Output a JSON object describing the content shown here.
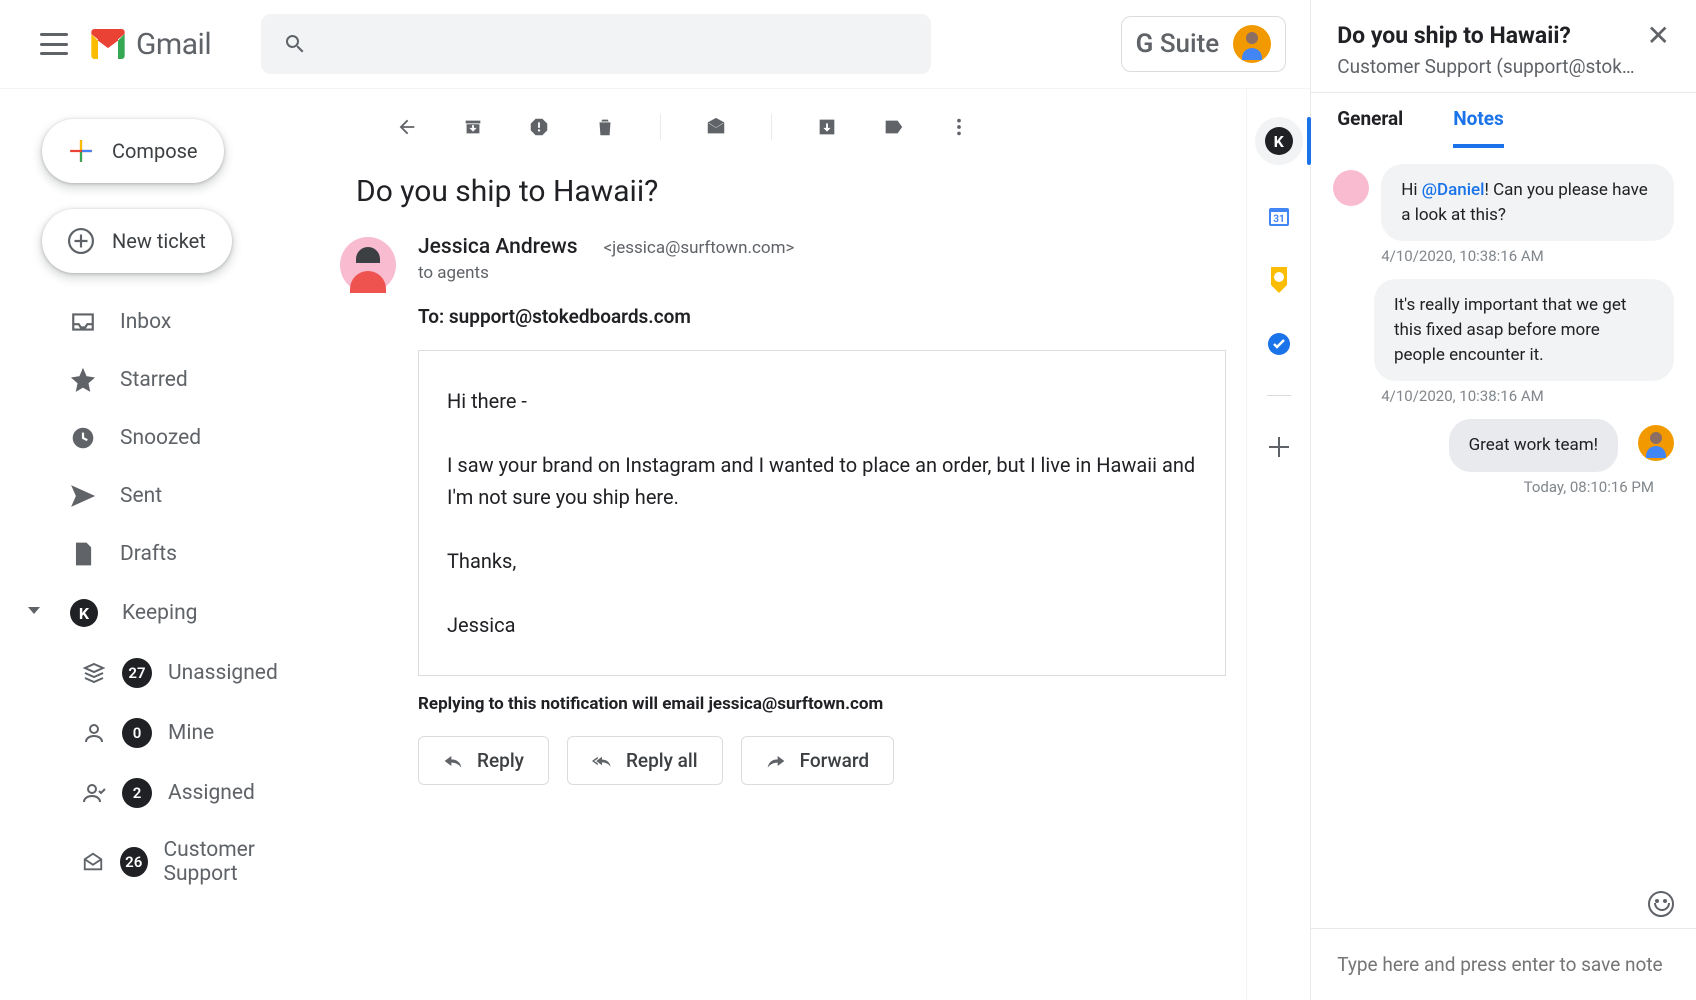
{
  "header": {
    "brand": "Gmail",
    "suite": "G Suite"
  },
  "sidebar": {
    "compose": "Compose",
    "newticket": "New ticket",
    "items": [
      {
        "label": "Inbox"
      },
      {
        "label": "Starred"
      },
      {
        "label": "Snoozed"
      },
      {
        "label": "Sent"
      },
      {
        "label": "Drafts"
      },
      {
        "label": "Keeping"
      }
    ],
    "sub": [
      {
        "count": "27",
        "label": "Unassigned"
      },
      {
        "count": "0",
        "label": "Mine"
      },
      {
        "count": "2",
        "label": "Assigned"
      },
      {
        "count": "26",
        "label": "Customer Support"
      }
    ]
  },
  "email": {
    "subject": "Do you ship to Hawaii?",
    "from_name": "Jessica Andrews",
    "from_email": "<jessica@surftown.com>",
    "to_agents": "to agents",
    "to_line": "To: support@stokedboards.com",
    "body_p1": "Hi there -",
    "body_p2": "I saw your brand on Instagram and I wanted to place an order, but I live in Hawaii and I'm not sure you ship here.",
    "body_p3": "Thanks,",
    "body_p4": "Jessica",
    "reply_note": "Replying to this notification will email jessica@surftown.com",
    "btn_reply": "Reply",
    "btn_replyall": "Reply all",
    "btn_forward": "Forward"
  },
  "panel": {
    "title": "Do you ship to Hawaii?",
    "subtitle": "Customer Support (support@stok…",
    "tab_general": "General",
    "tab_notes": "Notes",
    "notes": [
      {
        "pre": "Hi ",
        "mention": "@Daniel",
        "post": "! Can you please have a look at this?",
        "time": "4/10/2020, 10:38:16 AM"
      },
      {
        "text": "It's really important that we get this fixed asap before more people encounter it.",
        "time": "4/10/2020, 10:38:16 AM"
      },
      {
        "text": "Great work team!",
        "time": "Today, 08:10:16 PM"
      }
    ],
    "input_placeholder": "Type here and press enter to save note"
  }
}
